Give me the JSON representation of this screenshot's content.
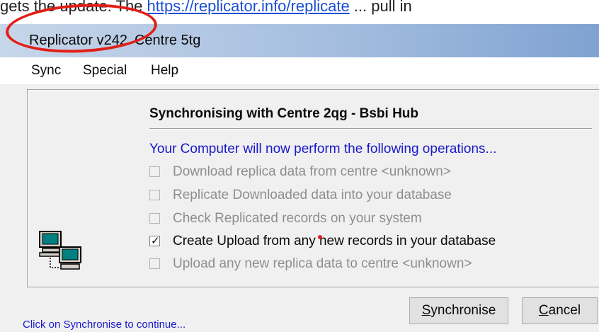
{
  "doc_fragment": {
    "before": "gets the update. The ",
    "link_text": "https://replicator.info/replicate",
    "after": " ... pull in"
  },
  "window": {
    "title": "Replicator v242",
    "subtitle": "Centre 5tg"
  },
  "menu": [
    "Sync",
    "Special",
    "Help"
  ],
  "dialog": {
    "heading": "Synchronising with Centre 2qg - Bsbi Hub",
    "intro": "Your Computer will now perform the following operations...",
    "operations": [
      {
        "label": "Download replica data from centre <unknown>",
        "checked": false,
        "enabled": false
      },
      {
        "label": "Replicate Downloaded data into your database",
        "checked": false,
        "enabled": false
      },
      {
        "label": "Check Replicated records on your system",
        "checked": false,
        "enabled": false
      },
      {
        "label": "Create Upload from any new records in your database",
        "checked": true,
        "enabled": true
      },
      {
        "label": "Upload any new replica data to centre <unknown>",
        "checked": false,
        "enabled": false
      }
    ],
    "icon": "networked-computers-icon"
  },
  "buttons": {
    "synchronise": {
      "first": "S",
      "rest": "ynchronise"
    },
    "cancel": {
      "first": "C",
      "rest": "ancel"
    }
  },
  "status": "Click on Synchronise to continue...",
  "colors": {
    "annotation": "#e21f17",
    "info_text": "#1919cc",
    "titlebar_start": "#c7d6e9",
    "titlebar_end": "#7fa2d1"
  }
}
